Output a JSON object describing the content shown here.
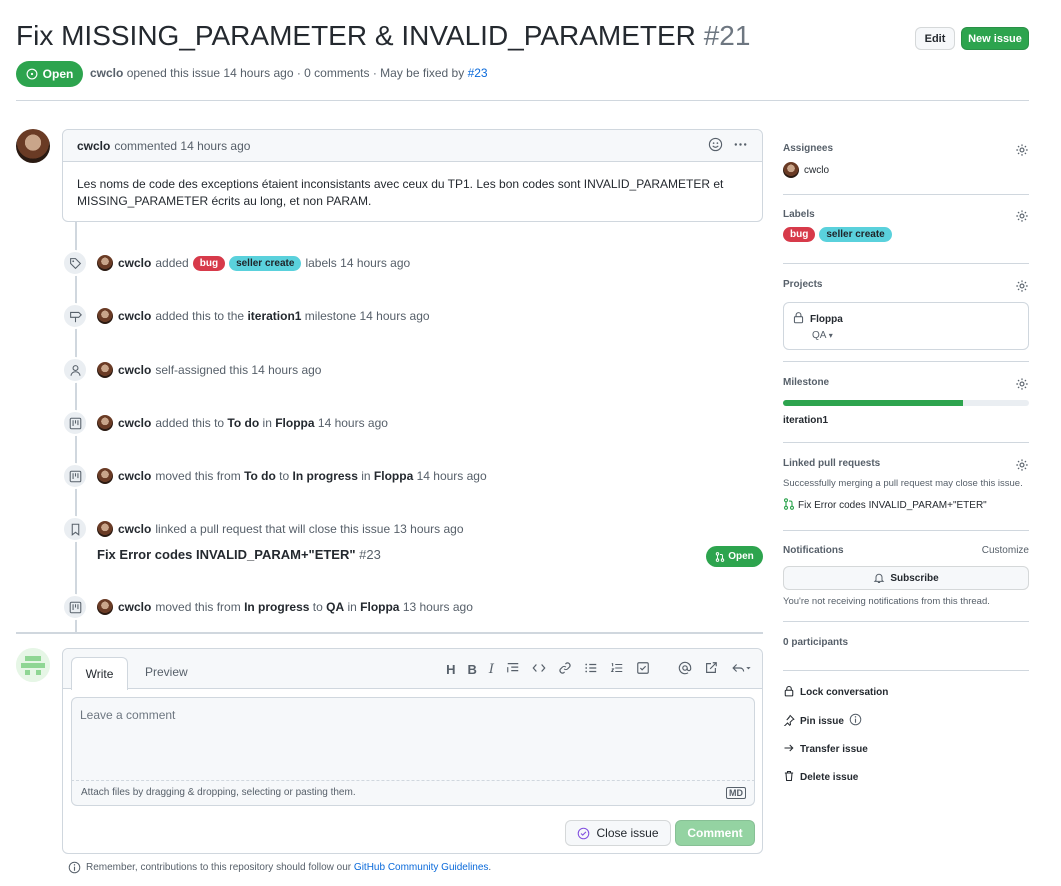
{
  "header": {
    "title": "Fix MISSING_PARAMETER & INVALID_PARAMETER",
    "number": "#21",
    "edit_label": "Edit",
    "new_issue_label": "New issue",
    "state": "Open",
    "author": "cwclo",
    "meta_text": "opened this issue 14 hours ago · 0 comments · May be fixed by",
    "fixed_by": "#23"
  },
  "comment": {
    "author": "cwclo",
    "time": "commented 14 hours ago",
    "body": "Les noms de code des exceptions étaient inconsistants avec ceux du TP1. Les bon codes sont INVALID_PARAMETER et MISSING_PARAMETER écrits au long, et non PARAM."
  },
  "events": [
    {
      "icon": "tag-icon",
      "actor": "cwclo",
      "pre": "added",
      "labels": [
        "bug",
        "seller create"
      ],
      "post": "labels 14 hours ago"
    },
    {
      "icon": "milestone-icon",
      "actor": "cwclo",
      "pre": "added this to the",
      "strong": "iteration1",
      "post": "milestone 14 hours ago"
    },
    {
      "icon": "person-icon",
      "actor": "cwclo",
      "pre": "self-assigned this 14 hours ago"
    },
    {
      "icon": "project-icon",
      "actor": "cwclo",
      "pre": "added this to",
      "strong": "To do",
      "mid": "in",
      "strong2": "Floppa",
      "post": "14 hours ago"
    },
    {
      "icon": "project-icon",
      "actor": "cwclo",
      "pre": "moved this from",
      "strong": "To do",
      "mid": "to",
      "strong2": "In progress",
      "mid2": "in",
      "strong3": "Floppa",
      "post": "14 hours ago"
    },
    {
      "icon": "bookmark-icon",
      "actor": "cwclo",
      "pre": "linked a pull request that will close this issue 13 hours ago"
    },
    {
      "icon": "project-icon",
      "actor": "cwclo",
      "pre": "moved this from",
      "strong": "In progress",
      "mid": "to",
      "strong2": "QA",
      "mid2": "in",
      "strong3": "Floppa",
      "post": "13 hours ago"
    }
  ],
  "linked_pr": {
    "title": "Fix Error codes INVALID_PARAM+\"ETER\"",
    "number": "#23",
    "state": "Open"
  },
  "composer": {
    "tab_write": "Write",
    "tab_preview": "Preview",
    "placeholder": "Leave a comment",
    "attach_text": "Attach files by dragging & dropping, selecting or pasting them.",
    "md_label": "MD",
    "close_issue_label": "Close issue",
    "comment_label": "Comment"
  },
  "footer": {
    "text": "Remember, contributions to this repository should follow our",
    "link": "GitHub Community Guidelines",
    "end": "."
  },
  "sidebar": {
    "assignees_title": "Assignees",
    "assignee": "cwclo",
    "labels_title": "Labels",
    "labels": [
      "bug",
      "seller create"
    ],
    "projects_title": "Projects",
    "project_name": "Floppa",
    "project_status": "QA",
    "milestone_title": "Milestone",
    "milestone_name": "iteration1",
    "milestone_progress": 0.73,
    "linked_title": "Linked pull requests",
    "linked_desc": "Successfully merging a pull request may close this issue.",
    "linked_pr": "Fix Error codes INVALID_PARAM+\"ETER\"",
    "notif_title": "Notifications",
    "customize": "Customize",
    "subscribe": "Subscribe",
    "notif_desc": "You're not receiving notifications from this thread.",
    "participants": "0 participants",
    "lock": "Lock conversation",
    "pin": "Pin issue",
    "transfer": "Transfer issue",
    "delete": "Delete issue"
  },
  "colors": {
    "open_green": "#2da44e",
    "bug_red": "#d73a4a",
    "seller_cyan": "#5ad1dc",
    "link_blue": "#0969da"
  }
}
